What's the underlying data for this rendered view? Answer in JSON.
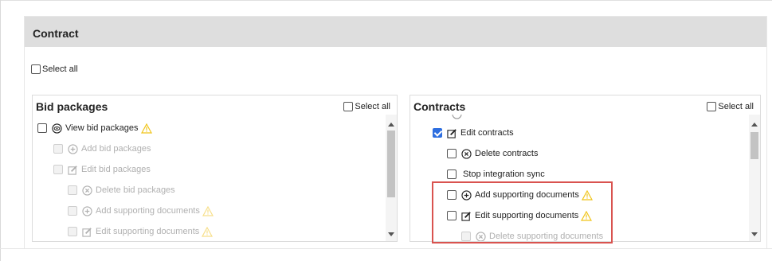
{
  "section": {
    "title": "Contract",
    "select_all_label": "Select all"
  },
  "bid_packages": {
    "title": "Bid packages",
    "select_all_label": "Select all",
    "items": [
      {
        "label": "View bid packages",
        "icon": "view-icon",
        "warning": true,
        "checked": false,
        "disabled": false
      },
      {
        "label": "Add bid packages",
        "icon": "add-icon",
        "warning": false,
        "checked": false,
        "disabled": true
      },
      {
        "label": "Edit bid packages",
        "icon": "edit-icon",
        "warning": false,
        "checked": false,
        "disabled": true
      },
      {
        "label": "Delete bid packages",
        "icon": "delete-icon",
        "warning": false,
        "checked": false,
        "disabled": true
      },
      {
        "label": "Add supporting documents",
        "icon": "add-icon",
        "warning": true,
        "checked": false,
        "disabled": true
      },
      {
        "label": "Edit supporting documents",
        "icon": "edit-icon",
        "warning": true,
        "checked": false,
        "disabled": true
      }
    ]
  },
  "contracts": {
    "title": "Contracts",
    "select_all_label": "Select all",
    "items": [
      {
        "label": "Edit contracts",
        "icon": "edit-icon",
        "warning": false,
        "checked": true,
        "disabled": false
      },
      {
        "label": "Delete contracts",
        "icon": "delete-icon",
        "warning": false,
        "checked": false,
        "disabled": false
      },
      {
        "label": "Stop integration sync",
        "icon": "",
        "warning": false,
        "checked": false,
        "disabled": false
      },
      {
        "label": "Add supporting documents",
        "icon": "add-icon",
        "warning": true,
        "checked": false,
        "disabled": false
      },
      {
        "label": "Edit supporting documents",
        "icon": "edit-icon",
        "warning": true,
        "checked": false,
        "disabled": false
      },
      {
        "label": "Delete supporting documents",
        "icon": "delete-icon",
        "warning": false,
        "checked": false,
        "disabled": true
      }
    ]
  },
  "colors": {
    "warning": "#f0c419",
    "highlight": "#d9534f",
    "checked": "#2d6ee0",
    "header_bg": "#dedede"
  }
}
